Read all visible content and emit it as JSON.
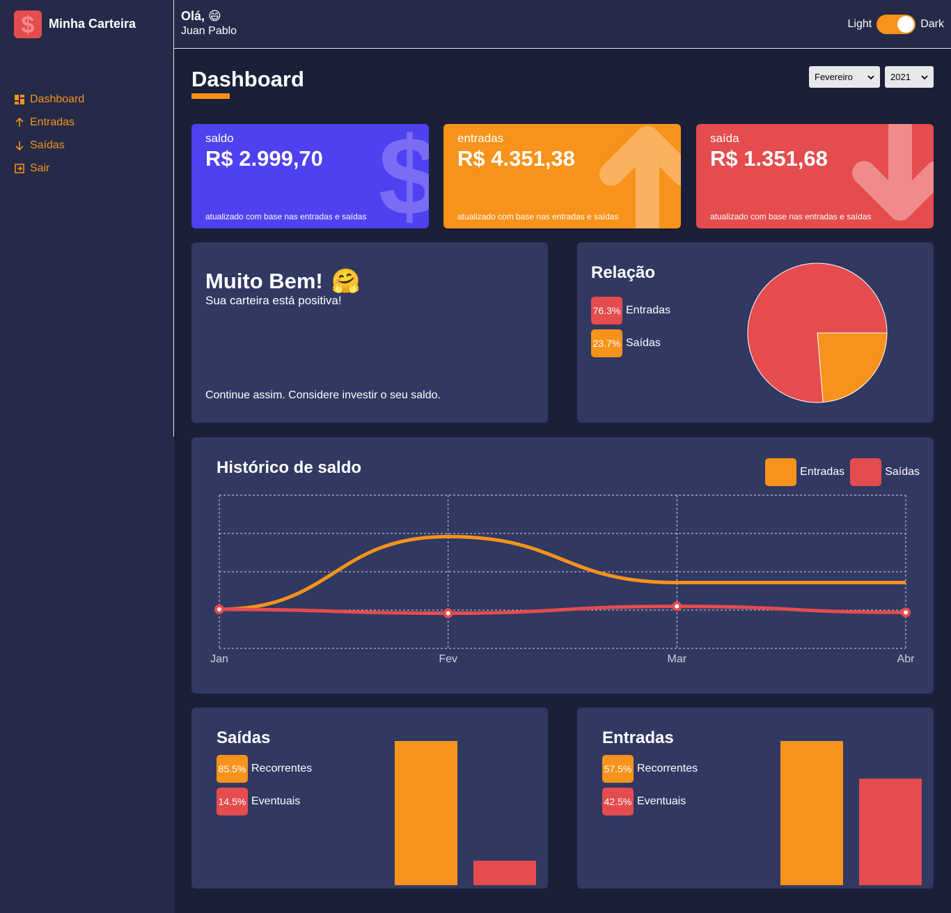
{
  "sidebar": {
    "app_name": "Minha Carteira",
    "menu": [
      {
        "label": "Dashboard",
        "icon": "dashboard-icon"
      },
      {
        "label": "Entradas",
        "icon": "arrow-up-icon"
      },
      {
        "label": "Saídas",
        "icon": "arrow-down-icon"
      },
      {
        "label": "Sair",
        "icon": "exit-icon"
      }
    ]
  },
  "header": {
    "greeting": "Olá, 😄",
    "username": "Juan Pablo",
    "toggle": {
      "left_label": "Light",
      "right_label": "Dark",
      "state": "dark"
    }
  },
  "content": {
    "title": "Dashboard",
    "month_select": "Fevereiro",
    "year_select": "2021"
  },
  "wallet_boxes": [
    {
      "title": "saldo",
      "amount": "R$ 2.999,70",
      "footer": "atualizado com base nas entradas e saídas",
      "color": "#4e41f0",
      "icon": "dollar-icon"
    },
    {
      "title": "entradas",
      "amount": "R$ 4.351,38",
      "footer": "atualizado com base nas entradas e saídas",
      "color": "#f7931b",
      "icon": "arrow-up-icon"
    },
    {
      "title": "saída",
      "amount": "R$ 1.351,68",
      "footer": "atualizado com base nas entradas e saídas",
      "color": "#e44c4e",
      "icon": "arrow-down-icon"
    }
  ],
  "message": {
    "title": "Muito Bem!",
    "emoji": "🤗",
    "subtitle": "Sua carteira está positiva!",
    "footer": "Continue assim. Considere investir o seu saldo."
  },
  "relation": {
    "title": "Relação",
    "legend": [
      {
        "percent": "76.3%",
        "label": "Entradas",
        "color": "#e44c4e"
      },
      {
        "percent": "23.7%",
        "label": "Saídas",
        "color": "#f7931b"
      }
    ]
  },
  "history": {
    "title": "Histórico de saldo",
    "legend": [
      {
        "label": "Entradas",
        "color": "#f7931b"
      },
      {
        "label": "Saídas",
        "color": "#e44c4e"
      }
    ]
  },
  "bar_cards": [
    {
      "title": "Saídas",
      "legend": [
        {
          "percent": "85.5%",
          "label": "Recorrentes",
          "color": "#f7931b"
        },
        {
          "percent": "14.5%",
          "label": "Eventuais",
          "color": "#e44c4e"
        }
      ]
    },
    {
      "title": "Entradas",
      "legend": [
        {
          "percent": "57.5%",
          "label": "Recorrentes",
          "color": "#f7931b"
        },
        {
          "percent": "42.5%",
          "label": "Eventuais",
          "color": "#e44c4e"
        }
      ]
    }
  ],
  "chart_data": [
    {
      "type": "pie",
      "labels": [
        "Entradas",
        "Saídas"
      ],
      "values": [
        76.3,
        23.7
      ],
      "colors": [
        "#e44c4e",
        "#f7931b"
      ]
    },
    {
      "type": "line",
      "x": [
        "Jan",
        "Fev",
        "Mar",
        "Abr"
      ],
      "ylim": [
        0,
        4
      ],
      "grid": true,
      "series": [
        {
          "name": "Entradas",
          "values": [
            0,
            1.9,
            0.7,
            0.7
          ],
          "color": "#f7931b"
        },
        {
          "name": "Saídas",
          "values": [
            0,
            -0.1,
            0.08,
            -0.08
          ],
          "color": "#e44c4e"
        }
      ]
    },
    {
      "type": "bar",
      "categories": [
        "Recorrentes",
        "Eventuais"
      ],
      "values": [
        85.5,
        14.5
      ],
      "colors": [
        "#f7931b",
        "#e44c4e"
      ]
    },
    {
      "type": "bar",
      "categories": [
        "Recorrentes",
        "Eventuais"
      ],
      "values": [
        57.5,
        42.5
      ],
      "colors": [
        "#f7931b",
        "#e44c4e"
      ]
    }
  ]
}
